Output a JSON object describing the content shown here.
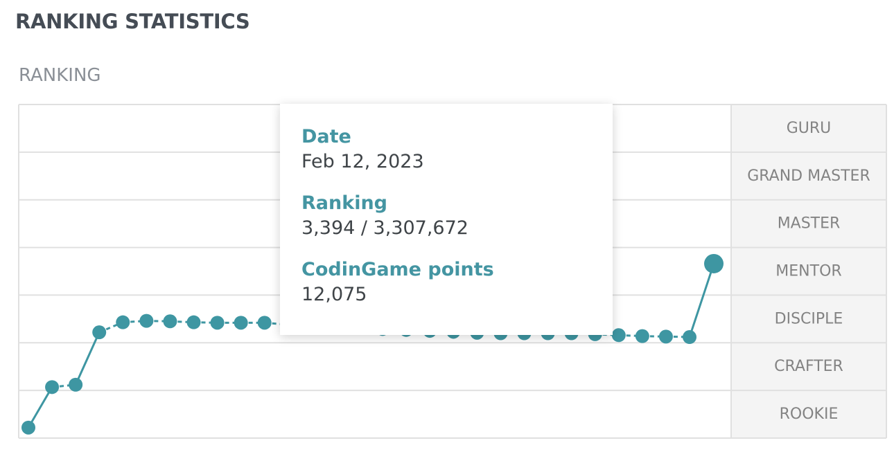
{
  "page": {
    "section_title": "RANKING STATISTICS",
    "chart_label": "RANKING"
  },
  "colors": {
    "line": "#3e96a2",
    "grid": "#e0e0e0",
    "band_bg": "#f4f4f4",
    "rank_text": "#838383",
    "tooltip_key": "#4495a2"
  },
  "tooltip": {
    "date_label": "Date",
    "date_value": "Feb 12, 2023",
    "ranking_label": "Ranking",
    "ranking_value": "3,394 / 3,307,672",
    "points_label": "CodinGame points",
    "points_value": "12,075"
  },
  "chart_data": {
    "type": "line",
    "title": "RANKING",
    "y_categories": [
      "ROOKIE",
      "CRAFTER",
      "DISCIPLE",
      "MENTOR",
      "MASTER",
      "GRAND MASTER",
      "GURU"
    ],
    "ylim": [
      0,
      7
    ],
    "grid": true,
    "series": [
      {
        "x": [
          0,
          1,
          2,
          3,
          4,
          5,
          6,
          7,
          8,
          9,
          10,
          11,
          12,
          13,
          14,
          15,
          16,
          17,
          18,
          19,
          20,
          21,
          22,
          23,
          24,
          25,
          26,
          27,
          28,
          29
        ],
        "values": [
          0.22,
          1.07,
          1.12,
          2.22,
          2.43,
          2.46,
          2.45,
          2.43,
          2.42,
          2.42,
          2.42,
          2.38,
          2.35,
          2.33,
          2.31,
          2.29,
          2.27,
          2.25,
          2.23,
          2.21,
          2.2,
          2.2,
          2.2,
          2.2,
          2.18,
          2.16,
          2.14,
          2.13,
          2.12,
          3.66
        ]
      }
    ]
  }
}
